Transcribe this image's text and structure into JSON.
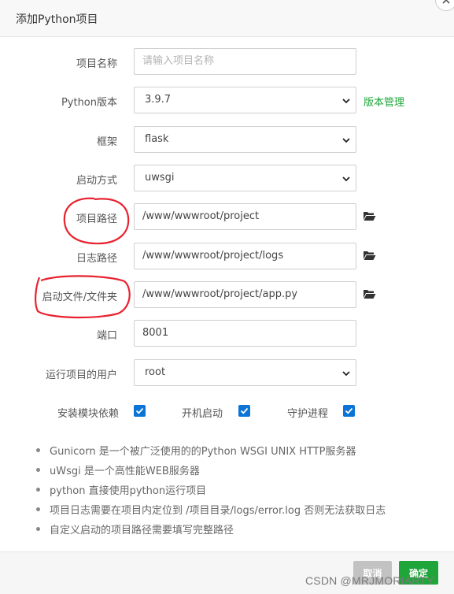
{
  "dialog": {
    "title": "添加Python项目"
  },
  "form": {
    "project_name": {
      "label": "项目名称",
      "placeholder": "请输入项目名称",
      "value": ""
    },
    "python_version": {
      "label": "Python版本",
      "value": "3.9.7",
      "manage_link": "版本管理"
    },
    "framework": {
      "label": "框架",
      "value": "flask"
    },
    "start_method": {
      "label": "启动方式",
      "value": "uwsgi"
    },
    "project_path": {
      "label": "项目路径",
      "value": "/www/wwwroot/project",
      "icon": "folder-open-icon"
    },
    "log_path": {
      "label": "日志路径",
      "value": "/www/wwwroot/project/logs",
      "icon": "folder-open-icon"
    },
    "startup_file": {
      "label": "启动文件/文件夹",
      "value": "/www/wwwroot/project/app.py",
      "icon": "folder-open-icon"
    },
    "port": {
      "label": "端口",
      "value": "8001"
    },
    "run_user": {
      "label": "运行项目的用户",
      "value": "root"
    }
  },
  "options": {
    "install_deps": {
      "label": "安装模块依赖",
      "checked": true
    },
    "autostart": {
      "label": "开机启动",
      "checked": true
    },
    "daemon": {
      "label": "守护进程",
      "checked": true
    }
  },
  "notes": [
    "Gunicorn 是一个被广泛使用的的Python WSGI UNIX HTTP服务器",
    "uWsgi 是一个高性能WEB服务器",
    "python 直接使用python运行项目",
    "项目日志需要在项目内定位到 /项目目录/logs/error.log 否则无法获取日志",
    "自定义启动的项目路径需要填写完整路径"
  ],
  "footer": {
    "cancel_label": "取消",
    "ok_label": "确定"
  },
  "watermark": "CSDN @MRJMORIARTY",
  "colors": {
    "accent_green": "#20a53a",
    "checkbox_blue": "#0b74d6",
    "annotation_red": "#e8232f"
  }
}
